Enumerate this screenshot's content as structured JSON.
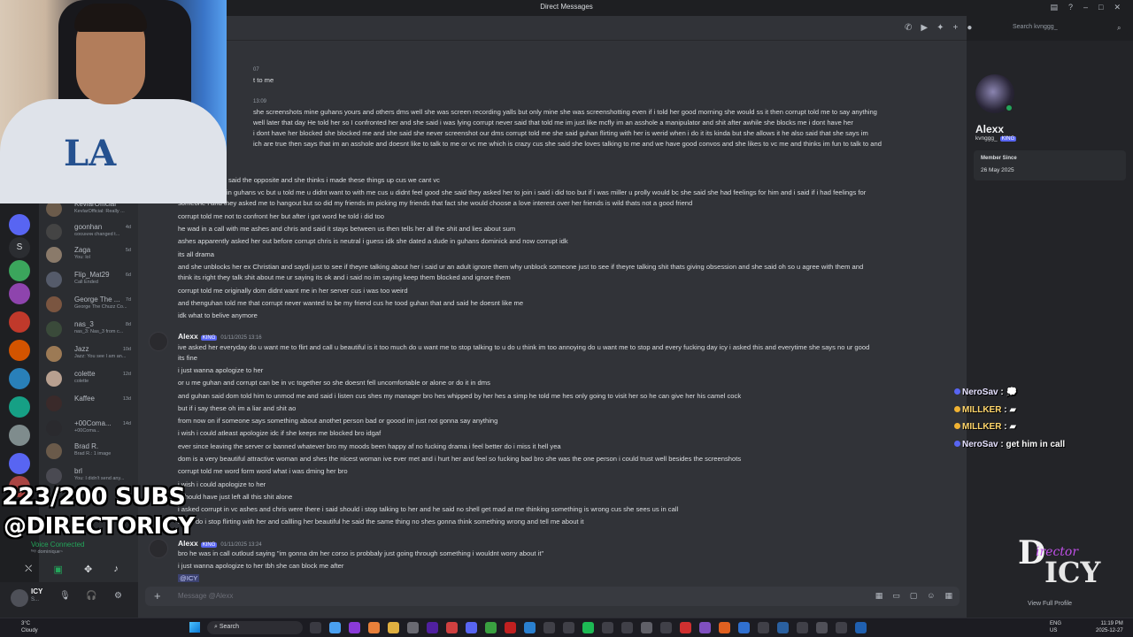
{
  "window": {
    "title": "Direct Messages"
  },
  "search": {
    "placeholder": "Search kvnggg_"
  },
  "dm_list": [
    {
      "name": "KevlarOfficial",
      "status": "KevlarOfficial: Really ...",
      "time": ""
    },
    {
      "name": "goonhan",
      "status": "ɢᴏɢᴜʜᴀɴ changed t...",
      "time": "4d"
    },
    {
      "name": "Zaga",
      "status": "You: lol",
      "time": "5d"
    },
    {
      "name": "Flip_Mat29",
      "status": "Call Ended",
      "time": "6d"
    },
    {
      "name": "George The ...",
      "status": "George The Chuzz Co...",
      "time": "7d"
    },
    {
      "name": "nas_3",
      "status": "nas_3: Nas_3 from c...",
      "time": "8d"
    },
    {
      "name": "Jazz",
      "status": "Jazz: You see I am an...",
      "time": "10d"
    },
    {
      "name": "colette",
      "status": "colette",
      "time": "12d"
    },
    {
      "name": "Kaffee",
      "status": "",
      "time": "13d"
    },
    {
      "name": "+00Coma...",
      "status": "+00Coma...",
      "time": "14d"
    },
    {
      "name": "Brad R.",
      "status": "Brad R.: 1 image",
      "time": ""
    },
    {
      "name": "brl",
      "status": "You: I didn't send any...",
      "time": ""
    }
  ],
  "voice": {
    "status": "Voice Connected",
    "channel": "ʰᵉʸ dominique~"
  },
  "user_panel": {
    "name": "ICY",
    "status": "S..."
  },
  "messages": {
    "top_ts": "07",
    "top_line": "t to me",
    "ts2": "13:09",
    "block1": [
      "she screenshots mine guhans yours and others dms well she was screen recording yalls but only mine she was screenshotting even if i told her good morning she would ss it then corrupt told me to say anything",
      "well later that day He told her so I confronted her and she said i was lying corrupt never said that told me im just like mcfly im an asshole a manipulator and shit after awhile she blocks me i dont have her",
      "i dont have her blocked she blocked me and she said she never screenshot our dms corrupt told me she said guhan flirting with her is werid when i do it its kinda but she allows it he also said that she says im",
      "ich are true then says that im an asshole and doesnt like to talk to me or vc me which is crazy cus she said she loves talking to me and we have good convos and she likes to vc me and thinks im fun to talk to and"
    ],
    "block2": [
      "said the opposite and she thinks i made these things up cus we cant vc",
      "in guhans vc but u told me u didnt want to with me cus u didnt feel good she said they asked her to join i said i did too but if i was miller u prolly would bc she said she had feelings for him and i said if i had feelings for",
      "someone i and they asked me to hangout but so did my friends im picking my friends that fact she would choose a love interest over her friends is wild thats not a good friend",
      "corrupt told me not to confront her but after i got word he told i did too",
      "he wad in a call with me ashes and chris and said it stays between us then tells her all the shit and lies about sum",
      "ashes apparently asked her out before corrupt chris is neutral i guess idk she dated a dude in guhans dominick and now corrupt idk",
      "its all drama",
      "and she unblocks her ex Christian and saydi just to see if theyre talking about her i said ur an adult ignore them why unblock someone just to see if theyre talking shit thats giving obsession and she said oh so u agree with them and",
      "think its right they talk shit about me ur saying its ok and i said no im saying keep them blocked and ignore them",
      "corrupt told me originally dom didnt want me in her server cus i was too weird",
      "and thenguhan told me that corrupt never wanted to be my friend cus he tood guhan that and said he doesnt like me",
      "idk what to belive anymore"
    ],
    "msg3": {
      "author": "Alexx",
      "tag": "KING",
      "time": "01/11/2025 13:16",
      "lines": [
        "ive asked her everyday do u want me to flirt and call u beautiful is it too much do u want me to stop talking to u do u think im too annoying do u want me to stop and every fucking day icy i asked this and everytime she says no ur good",
        "its fine",
        "i just wanna apologize to her",
        "or u me guhan and corrupt can be in vc together so she doesnt fell uncomfortable or alone or do it in dms",
        "and guhan said dom told him to unmod me and said i listen cus shes my manager bro hes whipped by her hes a simp he told me hes only going to visit her so he can give her his camel cock",
        "but if i say these oh im a liar and shit ao",
        "from now on if someone says something about anothet person bad or goood im just not gonna say anything",
        "i wish i could atleast apologize idc if she keeps me blocked bro idgaf",
        "ever since leaving the server or banned whatever bro my moods been happy af no fucking drama i feel better do i miss it hell yea",
        "dom is a very beautiful attractive woman and shes the nicest woman ive ever met and i hurt her and feel so fucking bad bro she was the one person i could trust well besides the screenshots",
        "corrupt told me word form word what i was dming her bro",
        "i wish i could apologize to her",
        "i should have just left all this shit alone",
        "i asked corrupt in vc ashes and chris were there i said should i stop talking to her and he said no shell get mad at me thinking something is wrong cus she sees us in call",
        "i said do i stop flirting with her and callling her beautiful he said the same thing no shes gonna think something wrong and tell me about it"
      ]
    },
    "msg4": {
      "author": "Alexx",
      "tag": "KING",
      "time": "01/11/2025 13:24",
      "lines": [
        "bro he was in call outloud saying \"im gonna dm her corso is probbaly just going through something i wouldnt worry about it\"",
        "i just wanna apologize to her tbh she can block me after"
      ],
      "mention": "@ICY"
    }
  },
  "composer": {
    "placeholder": "Message @Alexx"
  },
  "profile": {
    "name": "Alexx",
    "username": "kvnggg_",
    "tag": "KING",
    "member_since_label": "Member Since",
    "member_since": "26 May 2025",
    "view_full": "View Full Profile"
  },
  "overlay": {
    "subs": "223/200 SUBS",
    "handle": "@DIRECTORICY",
    "chat": [
      {
        "user": "NeroSav",
        "text": "",
        "mark": "#5865f2"
      },
      {
        "user": "MILLKER",
        "text": "",
        "mark": "#f0b232"
      },
      {
        "user": "MILLKER",
        "text": "",
        "mark": "#f0b232"
      },
      {
        "user": "NeroSav",
        "text": "get him in call",
        "mark": "#5865f2"
      }
    ],
    "logo": {
      "line1": "D",
      "line2": "irector",
      "line3": "ICY"
    }
  },
  "taskbar": {
    "weather_temp": "3°C",
    "weather_desc": "Cloudy",
    "search": "Search",
    "lang": "ENG",
    "region": "US",
    "time": "11:19 PM",
    "date": "2025-12-27"
  }
}
